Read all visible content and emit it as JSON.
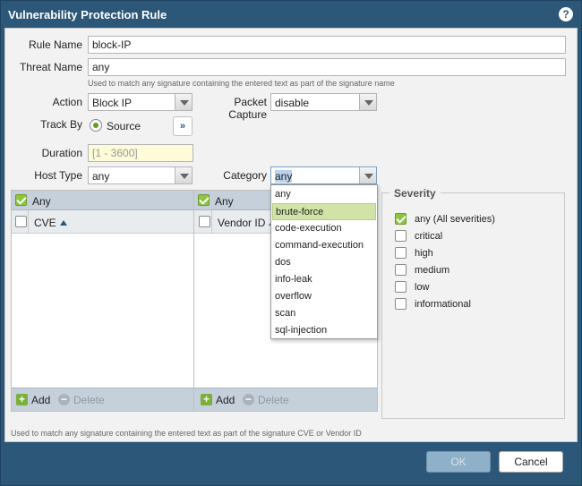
{
  "dialog": {
    "title": "Vulnerability Protection Rule",
    "help_glyph": "?"
  },
  "form": {
    "rule_name": {
      "label": "Rule Name",
      "value": "block-IP"
    },
    "threat_name": {
      "label": "Threat Name",
      "value": "any",
      "hint": "Used to match any signature containing the entered text as part of the signature name"
    },
    "action": {
      "label": "Action",
      "value": "Block IP"
    },
    "packet_capture": {
      "label": "Packet Capture",
      "value": "disable"
    },
    "track_by": {
      "label": "Track By",
      "value": "Source",
      "expand_glyph": "»"
    },
    "duration": {
      "label": "Duration",
      "placeholder": "[1 - 3600]"
    },
    "host_type": {
      "label": "Host Type",
      "value": "any"
    },
    "category": {
      "label": "Category",
      "value": "any"
    }
  },
  "category_dropdown": {
    "options": [
      "any",
      "brute-force",
      "code-execution",
      "command-execution",
      "dos",
      "info-leak",
      "overflow",
      "scan",
      "sql-injection"
    ],
    "highlighted": "brute-force"
  },
  "cve_panel": {
    "any_label": "Any",
    "column": "CVE",
    "add": "Add",
    "delete": "Delete"
  },
  "vendor_panel": {
    "any_label": "Any",
    "column": "Vendor ID",
    "add": "Add",
    "delete": "Delete"
  },
  "severity": {
    "legend": "Severity",
    "items": [
      {
        "label": "any (All severities)",
        "checked": true
      },
      {
        "label": "critical",
        "checked": false
      },
      {
        "label": "high",
        "checked": false
      },
      {
        "label": "medium",
        "checked": false
      },
      {
        "label": "low",
        "checked": false
      },
      {
        "label": "informational",
        "checked": false
      }
    ]
  },
  "bottom_hint": "Used to match any signature containing the entered text as part of the signature CVE or Vendor ID",
  "buttons": {
    "ok": "OK",
    "cancel": "Cancel"
  },
  "colors": {
    "titlebar": "#2c5778",
    "highlight": "#d1e3a7",
    "check": "#8dc63f"
  }
}
